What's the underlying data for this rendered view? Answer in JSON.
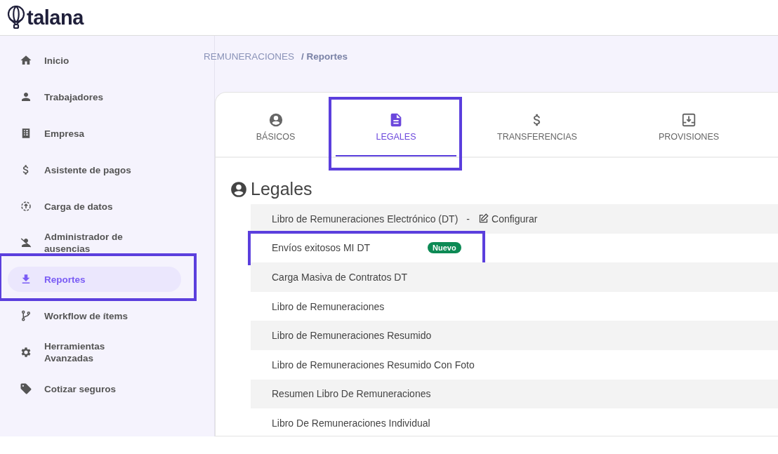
{
  "logo": {
    "text": "talana"
  },
  "sidebar": {
    "items": [
      {
        "label": "Inicio",
        "selected": false,
        "highlighted": false
      },
      {
        "label": "Trabajadores",
        "selected": false,
        "highlighted": false
      },
      {
        "label": "Empresa",
        "selected": false,
        "highlighted": false
      },
      {
        "label": "Asistente de pagos",
        "selected": false,
        "highlighted": false
      },
      {
        "label": "Carga de datos",
        "selected": false,
        "highlighted": false
      },
      {
        "label": "Administrador de ausencias",
        "selected": false,
        "highlighted": false
      },
      {
        "label": "Reportes",
        "selected": true,
        "highlighted": true
      },
      {
        "label": "Workflow de ítems",
        "selected": false,
        "highlighted": false
      },
      {
        "label": "Herramientas Avanzadas",
        "selected": false,
        "highlighted": false
      },
      {
        "label": "Cotizar seguros",
        "selected": false,
        "highlighted": false
      }
    ]
  },
  "breadcrumb": {
    "section": "REMUNERACIONES",
    "page": "/ Reportes"
  },
  "tabs": [
    {
      "label": "BÁSICOS",
      "selected": false,
      "highlighted": false
    },
    {
      "label": "LEGALES",
      "selected": true,
      "highlighted": true
    },
    {
      "label": "TRANSFERENCIAS",
      "selected": false,
      "highlighted": false
    },
    {
      "label": "PROVISIONES",
      "selected": false,
      "highlighted": false
    }
  ],
  "section": {
    "title": "Legales"
  },
  "reports": [
    {
      "label": "Libro de Remuneraciones Electrónico (DT)",
      "separator": "-",
      "action": "Configurar",
      "highlighted": false
    },
    {
      "label": "Envíos exitosos MI DT",
      "badge": "Nuevo",
      "highlighted": true
    },
    {
      "label": "Carga Masiva de Contratos DT",
      "highlighted": false
    },
    {
      "label": "Libro de Remuneraciones",
      "highlighted": false
    },
    {
      "label": "Libro de Remuneraciones Resumido",
      "highlighted": false
    },
    {
      "label": "Libro de Remuneraciones Resumido Con Foto",
      "highlighted": false
    },
    {
      "label": "Resumen Libro De Remuneraciones",
      "highlighted": false
    },
    {
      "label": "Libro De Remuneraciones Individual",
      "highlighted": false
    }
  ]
}
